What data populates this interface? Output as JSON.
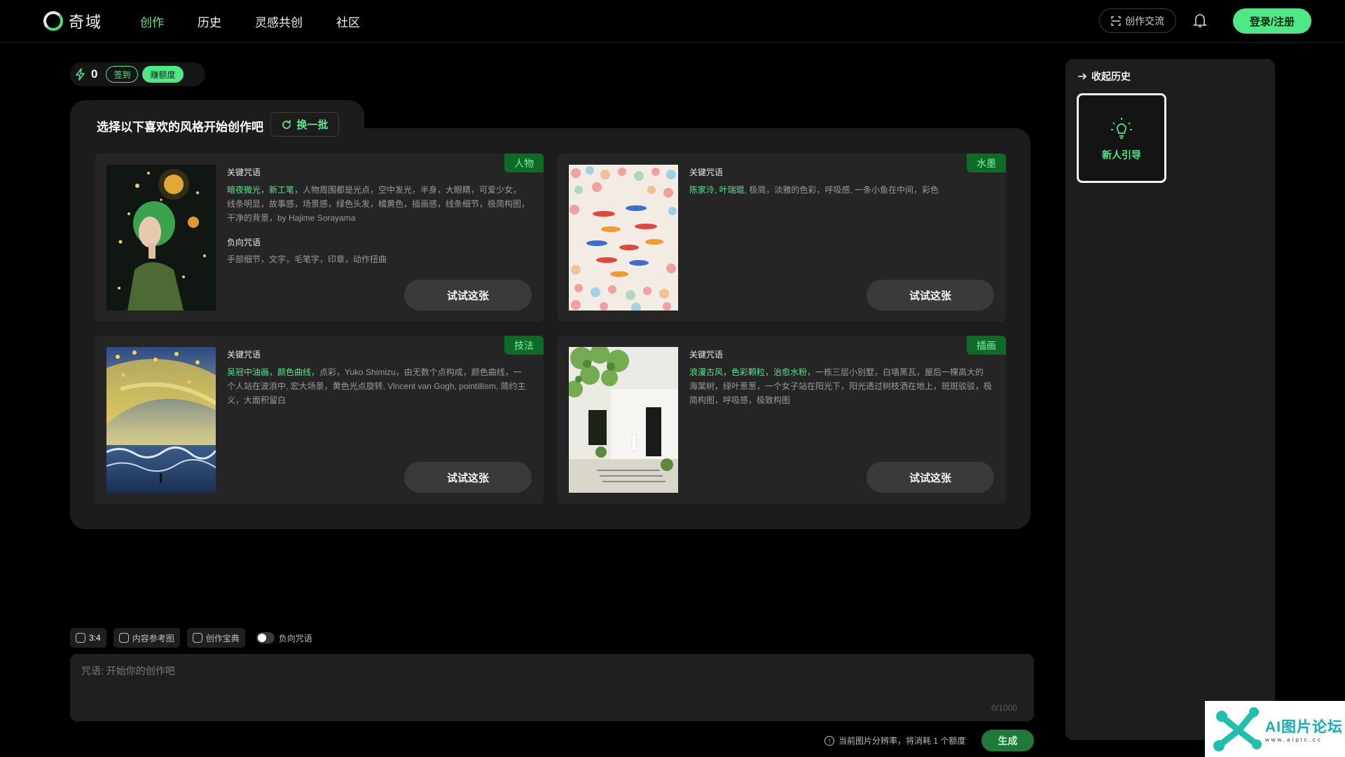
{
  "header": {
    "logo_text": "奇域",
    "nav": [
      "创作",
      "历史",
      "灵感共创",
      "社区"
    ],
    "exchange_label": "创作交流",
    "login_label": "登录/注册"
  },
  "credits": {
    "count": "0",
    "checkin_label": "签到",
    "earn_label": "赚额度"
  },
  "style_panel": {
    "title": "选择以下喜欢的风格开始创作吧",
    "refresh_label": "换一批",
    "keyword_label": "关键咒语",
    "negative_label": "负向咒语",
    "try_label": "试试这张",
    "cards": [
      {
        "tag": "人物",
        "kw_highlight": "暗夜微光，新工笔，",
        "kw_text": "人物周围都是光点，空中发光，半身，大眼睛，可爱少女，线条明显，故事感，场景感，绿色头发，橘黄色，插画感，线条细节，极简构图，干净的背景，by Hajime Sorayama",
        "negative": "手部细节，文字，毛笔字，印章，动作扭曲"
      },
      {
        "tag": "水墨",
        "kw_highlight": "陈家泠, 叶瑞琨,",
        "kw_text": " 极简，淡雅的色彩，呼吸感, 一条小鱼在中间，彩色"
      },
      {
        "tag": "技法",
        "kw_highlight": "吴冠中油画，颜色曲线，",
        "kw_text": "点彩，Yuko Shimizu，由无数个点构成，颜色曲线，一个人站在波浪中, 宏大场景，黄色光点旋转, Vincent van Gogh, pointillism, 简约主义，大面积留白"
      },
      {
        "tag": "插画",
        "kw_highlight": "浪漫古风，色彩颗粒，治愈水粉，",
        "kw_text": "一栋三层小别墅，白墙黑瓦，屋后一棵高大的海棠树，绿叶葱葱，一个女子站在阳光下，阳光透过树枝洒在地上，斑斑驳驳，极简构图，呼吸感，极致构图"
      }
    ]
  },
  "toolbar": {
    "ratio": "3:4",
    "ref_image": "内容参考图",
    "codex": "创作宝典",
    "negative_toggle": "负向咒语"
  },
  "prompt": {
    "placeholder": "咒语: 开始你的创作吧",
    "counter": "0/1000"
  },
  "footer": {
    "cost_note": "当前图片分辨率，将消耗 1 个额度",
    "generate_label": "生成"
  },
  "sidebar": {
    "collapse_label": "收起历史",
    "guide_label": "新人引导"
  },
  "watermark": {
    "title": "AI图片论坛",
    "url": "www.aiplc.cc"
  },
  "colors": {
    "accent": "#4ee887",
    "background": "#000000",
    "panel": "#1c1c1c",
    "card": "#252525",
    "tag_bg": "#0e6b27"
  }
}
